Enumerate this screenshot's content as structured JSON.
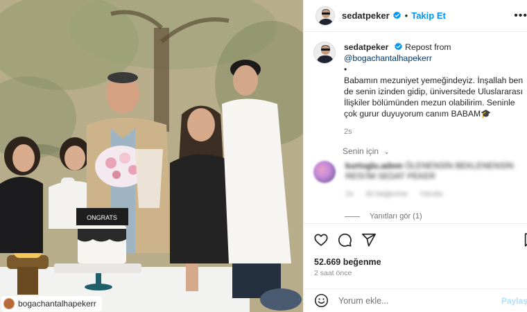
{
  "post": {
    "username": "sedatpeker",
    "follow_label": "Takip Et",
    "more_label": "•••",
    "photo_tag": "bogachantalhapekerr",
    "cake_text": "ONGRATS"
  },
  "caption": {
    "username": "sedatpeker",
    "repost_prefix": "Repost from",
    "mention": "@bogachantalhapekerr",
    "bullet": "•",
    "text": "Babamın mezuniyet yemeğindeyiz. İnşallah ben de senin izinden gidip, üniversitede Uluslararası İlişkiler bölümünden mezun olabilirim. Seninle çok gurur duyuyorum canım BABAM🎓",
    "time": "2s"
  },
  "for_you_label": "Senin için",
  "comment": {
    "username": "kurtoglu.adem",
    "text": "ÖLENENSİN BEKLENENSİN REİS'İM SEDAT PEKER",
    "time": "2s",
    "likes": "30 beğenme",
    "reply": "Yanıtla"
  },
  "replies_label": "Yanıtları gör (1)",
  "likes_label": "52.669 beğenme",
  "time_ago": "2 saat önce",
  "add_comment": {
    "placeholder": "Yorum ekle...",
    "post_label": "Paylaş"
  },
  "colors": {
    "accent": "#0095f6",
    "verified": "#0095f6",
    "post_disabled": "#b2dffc",
    "muted": "#8e8e8e"
  },
  "icons": [
    "verified-badge-icon",
    "more-options-icon",
    "chevron-down-icon",
    "heart-icon",
    "comment-icon",
    "share-icon",
    "bookmark-icon",
    "emoji-icon"
  ]
}
